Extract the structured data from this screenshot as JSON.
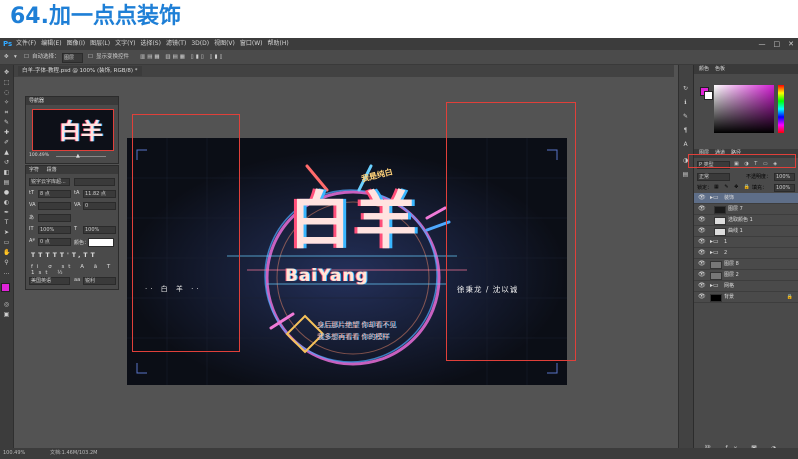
{
  "page": {
    "title": "64.加一点点装饰"
  },
  "app": {
    "logo": "Ps",
    "menu": [
      "文件(F)",
      "编辑(E)",
      "图像(I)",
      "图层(L)",
      "文字(Y)",
      "选择(S)",
      "滤镜(T)",
      "3D(D)",
      "视图(V)",
      "窗口(W)",
      "帮助(H)"
    ],
    "window_controls": [
      "—",
      "□",
      "✕"
    ]
  },
  "options_bar": {
    "auto_select_label": "自动选择：",
    "auto_select_value": "图层",
    "show_transform_label": "显示变换控件"
  },
  "document": {
    "tab_title": "白羊-字体-教程.psd @ 100% (装饰, RGB/8) *"
  },
  "navigator": {
    "title": "导航器",
    "zoom": "100.49%"
  },
  "character": {
    "tabs": [
      "字符",
      "段落"
    ],
    "font_family": "锐字云字库超...",
    "font_size": "8 点",
    "leading": "11.82 点",
    "tracking": "0",
    "scale_v": "100%",
    "scale_h": "100%",
    "baseline": "0 点",
    "color_label": "颜色：",
    "language": "美国英语",
    "antialias": "锐利"
  },
  "artwork": {
    "main_title": "白羊",
    "subtitle": "BaiYang",
    "top_tag": "我是纯白",
    "left_text": "·· 白 羊 ··",
    "right_text": "徐秉龙 / 沈以诚",
    "lyrics": [
      "身后那片绝望 你却看不见",
      "我多想再看看 你的模样"
    ]
  },
  "right_panel": {
    "top_tabs": [
      "颜色",
      "色板"
    ],
    "layers_tabs": [
      "图层",
      "通道",
      "路径"
    ],
    "filter_label": "P 类型",
    "blend_mode": "正常",
    "opacity_label": "不透明度：",
    "opacity": "100%",
    "lock_label": "锁定：",
    "fill_label": "填充：",
    "fill": "100%",
    "layers": [
      {
        "name": "装饰",
        "type": "folder",
        "selected": true
      },
      {
        "name": "图层 7",
        "type": "layer",
        "selected": false
      },
      {
        "name": "选取颜色 1",
        "type": "adjust",
        "selected": false
      },
      {
        "name": "曲线 1",
        "type": "adjust",
        "selected": false
      },
      {
        "name": "1",
        "type": "folder",
        "selected": false
      },
      {
        "name": "2",
        "type": "folder",
        "selected": false
      },
      {
        "name": "图层 8",
        "type": "layer",
        "selected": false
      },
      {
        "name": "图层 2",
        "type": "layer",
        "selected": false
      },
      {
        "name": "网格",
        "type": "folder",
        "selected": false
      },
      {
        "name": "背景",
        "type": "layer",
        "selected": false
      }
    ]
  },
  "status": {
    "zoom": "100.49%",
    "doc": "文档:1.46M/103.2M"
  },
  "colors": {
    "foreground": "#e023d8",
    "background": "#ffffff",
    "highlight": "#e0403a",
    "title": "#1e7fd6"
  }
}
